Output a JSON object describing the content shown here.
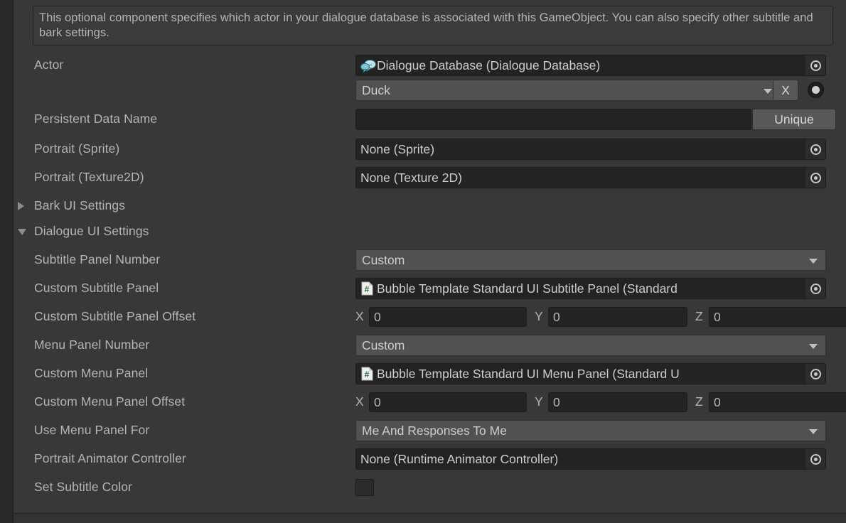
{
  "help_box": {
    "text": "This optional component specifies which actor in your dialogue database is associated with this GameObject. You can also specify other subtitle and bark settings."
  },
  "colors": {
    "panel_bg": "#383838",
    "field_dark": "#232323",
    "popup_gray": "#515151",
    "label_text": "#b4b4b4",
    "value_text": "#cdcdcd",
    "bubble_icon": "#9fd8e0",
    "prefab_hash": "#2d6b33",
    "subtitle_color_swatch": "#2b2b2b"
  },
  "fields": {
    "actor": {
      "label": "Actor",
      "object_value": "Dialogue Database (Dialogue Database)",
      "object_icon": "dialogue-database-icon",
      "picker_icon": "object-picker-icon",
      "dropdown_value": "Duck",
      "clear_button": "X",
      "radio_state": "on"
    },
    "persistent_data_name": {
      "label": "Persistent Data Name",
      "value": "",
      "button": "Unique"
    },
    "portrait_sprite": {
      "label": "Portrait (Sprite)",
      "value": "None (Sprite)"
    },
    "portrait_texture2d": {
      "label": "Portrait (Texture2D)",
      "value": "None (Texture 2D)"
    },
    "bark_ui_settings": {
      "label": "Bark UI Settings",
      "expanded": false
    },
    "dialogue_ui_settings": {
      "label": "Dialogue UI Settings",
      "expanded": true
    },
    "subtitle_panel_number": {
      "label": "Subtitle Panel Number",
      "value": "Custom"
    },
    "custom_subtitle_panel": {
      "label": "Custom Subtitle Panel",
      "value": "Bubble Template Standard UI Subtitle Panel (Standard"
    },
    "custom_subtitle_panel_offset": {
      "label": "Custom Subtitle Panel Offset",
      "x_label": "X",
      "x": "0",
      "y_label": "Y",
      "y": "0",
      "z_label": "Z",
      "z": "0"
    },
    "menu_panel_number": {
      "label": "Menu Panel Number",
      "value": "Custom"
    },
    "custom_menu_panel": {
      "label": "Custom Menu Panel",
      "value": "Bubble Template Standard UI Menu Panel (Standard U"
    },
    "custom_menu_panel_offset": {
      "label": "Custom Menu Panel Offset",
      "x_label": "X",
      "x": "0",
      "y_label": "Y",
      "y": "0",
      "z_label": "Z",
      "z": "0"
    },
    "use_menu_panel_for": {
      "label": "Use Menu Panel For",
      "value": "Me And Responses To Me"
    },
    "portrait_animator_controller": {
      "label": "Portrait Animator Controller",
      "value": "None (Runtime Animator Controller)"
    },
    "set_subtitle_color": {
      "label": "Set Subtitle Color",
      "value": ""
    }
  }
}
